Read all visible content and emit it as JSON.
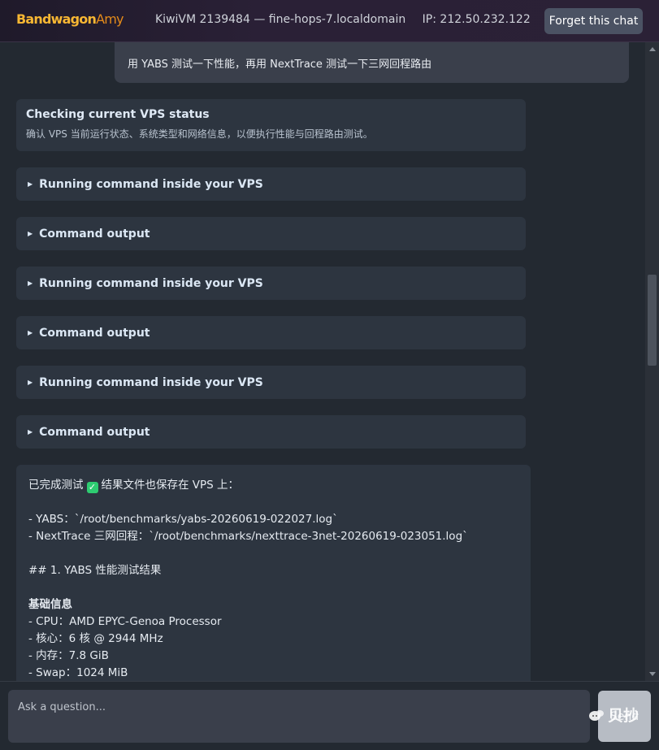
{
  "header": {
    "brand_part1": "Bandwagon",
    "brand_part2": "Amy",
    "vm_info": "KiwiVM 2139484 — fine-hops-7.localdomain",
    "ip": "IP: 212.50.232.122",
    "forget_label": "Forget this chat"
  },
  "user_message": "用 YABS 测试一下性能，再用 NextTrace 测试一下三网回程路由",
  "status": {
    "title": "Checking current VPS status",
    "description": "确认 VPS 当前运行状态、系统类型和网络信息，以便执行性能与回程路由测试。"
  },
  "collapsibles": [
    {
      "label": "Running command inside your VPS"
    },
    {
      "label": "Command output"
    },
    {
      "label": "Running command inside your VPS"
    },
    {
      "label": "Command output"
    },
    {
      "label": "Running command inside your VPS"
    },
    {
      "label": "Command output"
    }
  ],
  "result": {
    "intro_before": "已完成测试",
    "intro_after": "结果文件也保存在 VPS 上：",
    "check_glyph": "✓",
    "files": [
      "- YABS：`/root/benchmarks/yabs-20260619-022027.log`",
      "- NextTrace 三网回程：`/root/benchmarks/nexttrace-3net-20260619-023051.log`"
    ],
    "section_heading": "## 1. YABS 性能测试结果",
    "basic_title": "基础信息",
    "basic_items": [
      "- CPU：AMD EPYC-Genoa Processor",
      "- 核心：6 核 @ 2944 MHz",
      "- 内存：7.8 GiB",
      "- Swap：1024 MiB"
    ]
  },
  "composer": {
    "placeholder": "Ask a question...",
    "send_label": "Send"
  },
  "watermark": "贝抄"
}
